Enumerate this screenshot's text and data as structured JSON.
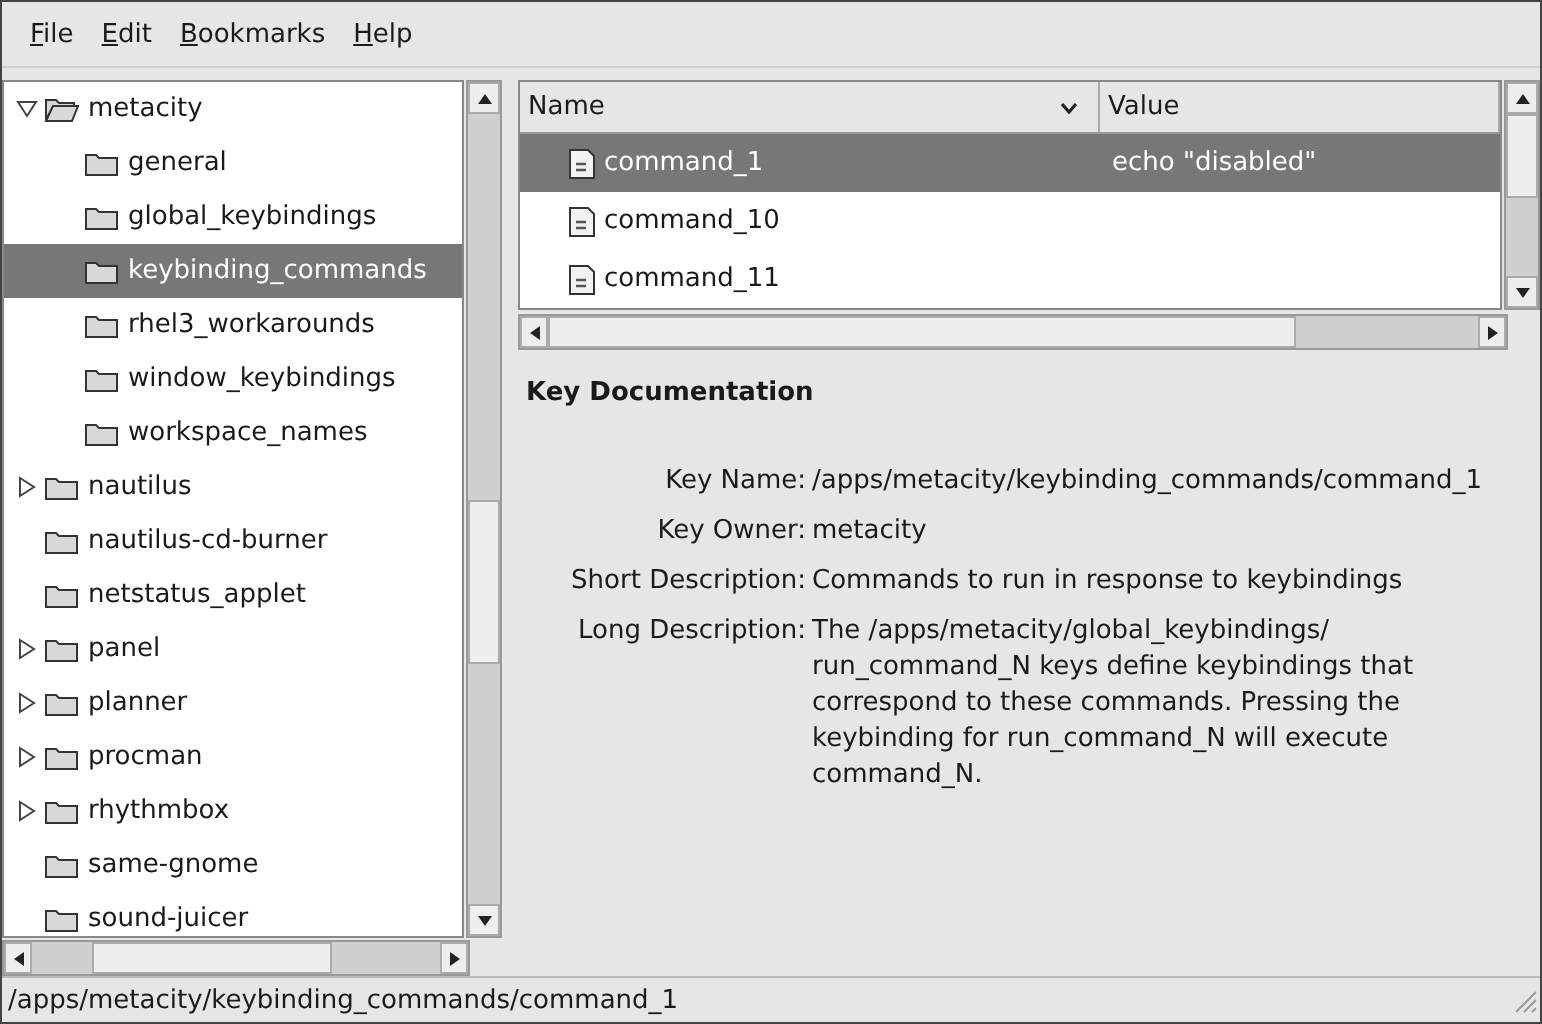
{
  "menu": [
    "File",
    "Edit",
    "Bookmarks",
    "Help"
  ],
  "tree": [
    {
      "label": "metacity",
      "kind": "branch",
      "expanded": true,
      "selected": false,
      "children": [
        {
          "label": "general",
          "kind": "leaf",
          "selected": false
        },
        {
          "label": "global_keybindings",
          "kind": "leaf",
          "selected": false
        },
        {
          "label": "keybinding_commands",
          "kind": "leaf",
          "selected": true
        },
        {
          "label": "rhel3_workarounds",
          "kind": "leaf",
          "selected": false
        },
        {
          "label": "window_keybindings",
          "kind": "leaf",
          "selected": false
        },
        {
          "label": "workspace_names",
          "kind": "leaf",
          "selected": false
        }
      ]
    },
    {
      "label": "nautilus",
      "kind": "branch",
      "expanded": false,
      "selected": false
    },
    {
      "label": "nautilus-cd-burner",
      "kind": "leaf",
      "selected": false
    },
    {
      "label": "netstatus_applet",
      "kind": "leaf",
      "selected": false
    },
    {
      "label": "panel",
      "kind": "branch",
      "expanded": false,
      "selected": false
    },
    {
      "label": "planner",
      "kind": "branch",
      "expanded": false,
      "selected": false
    },
    {
      "label": "procman",
      "kind": "branch",
      "expanded": false,
      "selected": false
    },
    {
      "label": "rhythmbox",
      "kind": "branch",
      "expanded": false,
      "selected": false
    },
    {
      "label": "same-gnome",
      "kind": "leaf",
      "selected": false
    },
    {
      "label": "sound-juicer",
      "kind": "leaf",
      "selected": false
    }
  ],
  "table": {
    "columns": [
      "Name",
      "Value"
    ],
    "rows": [
      {
        "name": "command_1",
        "value": "echo \"disabled\"",
        "selected": true
      },
      {
        "name": "command_10",
        "value": "",
        "selected": false
      },
      {
        "name": "command_11",
        "value": "",
        "selected": false
      }
    ]
  },
  "documentation": {
    "title": "Key Documentation",
    "fields": [
      {
        "label": "Key Name:",
        "value": "/apps/metacity/keybinding_commands/command_1"
      },
      {
        "label": "Key Owner:",
        "value": "metacity"
      },
      {
        "label": "Short Description:",
        "value": "Commands to run in response to keybindings"
      },
      {
        "label": "Long Description:",
        "value": "The /apps/metacity/global_keybindings/ run_command_N keys define keybindings that correspond to these commands. Pressing the keybinding for run_command_N will execute command_N."
      }
    ]
  },
  "status_bar": "/apps/metacity/keybinding_commands/command_1"
}
